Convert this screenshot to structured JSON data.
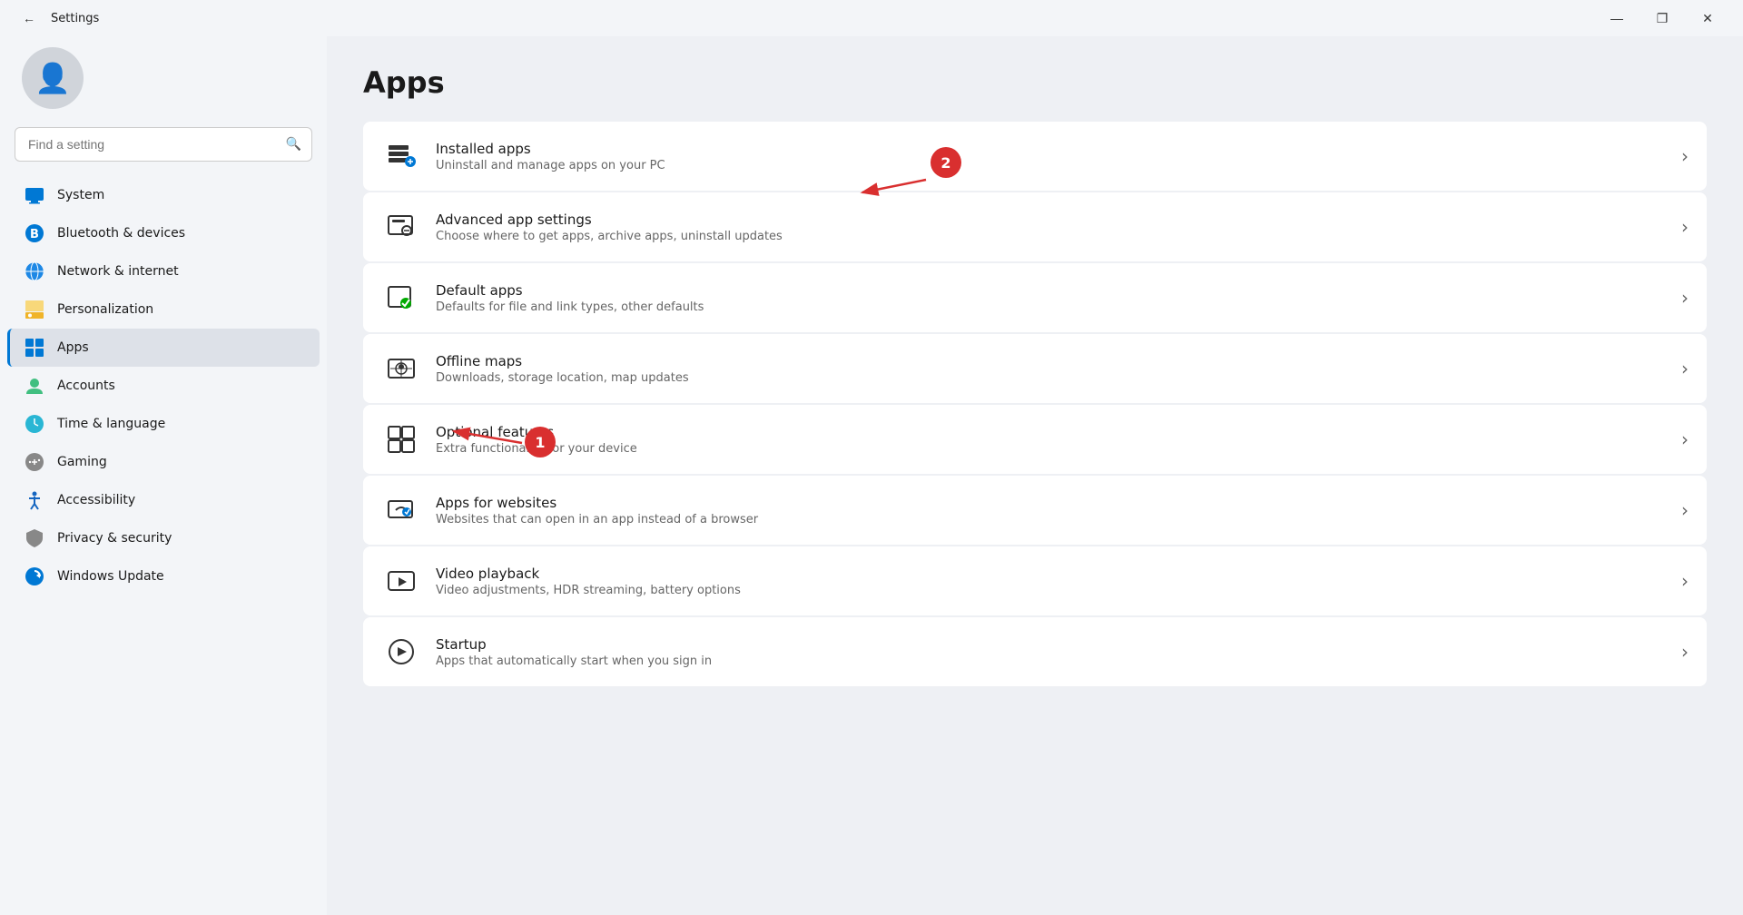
{
  "titlebar": {
    "back_label": "←",
    "title": "Settings",
    "minimize_label": "—",
    "maximize_label": "❐",
    "close_label": "✕"
  },
  "sidebar": {
    "search_placeholder": "Find a setting",
    "nav_items": [
      {
        "id": "system",
        "label": "System",
        "icon": "🖥️",
        "active": false
      },
      {
        "id": "bluetooth",
        "label": "Bluetooth & devices",
        "icon": "🔵",
        "active": false
      },
      {
        "id": "network",
        "label": "Network & internet",
        "icon": "🌐",
        "active": false
      },
      {
        "id": "personalization",
        "label": "Personalization",
        "icon": "✏️",
        "active": false
      },
      {
        "id": "apps",
        "label": "Apps",
        "icon": "📦",
        "active": true
      },
      {
        "id": "accounts",
        "label": "Accounts",
        "icon": "👤",
        "active": false
      },
      {
        "id": "time",
        "label": "Time & language",
        "icon": "🕐",
        "active": false
      },
      {
        "id": "gaming",
        "label": "Gaming",
        "icon": "🎮",
        "active": false
      },
      {
        "id": "accessibility",
        "label": "Accessibility",
        "icon": "♿",
        "active": false
      },
      {
        "id": "privacy",
        "label": "Privacy & security",
        "icon": "🛡️",
        "active": false
      },
      {
        "id": "windowsupdate",
        "label": "Windows Update",
        "icon": "🔄",
        "active": false
      }
    ]
  },
  "content": {
    "page_title": "Apps",
    "items": [
      {
        "id": "installed-apps",
        "title": "Installed apps",
        "description": "Uninstall and manage apps on your PC",
        "icon": "☰"
      },
      {
        "id": "advanced-app-settings",
        "title": "Advanced app settings",
        "description": "Choose where to get apps, archive apps, uninstall updates",
        "icon": "⚙️"
      },
      {
        "id": "default-apps",
        "title": "Default apps",
        "description": "Defaults for file and link types, other defaults",
        "icon": "✅"
      },
      {
        "id": "offline-maps",
        "title": "Offline maps",
        "description": "Downloads, storage location, map updates",
        "icon": "🗺️"
      },
      {
        "id": "optional-features",
        "title": "Optional features",
        "description": "Extra functionality for your device",
        "icon": "⊞"
      },
      {
        "id": "apps-for-websites",
        "title": "Apps for websites",
        "description": "Websites that can open in an app instead of a browser",
        "icon": "🔗"
      },
      {
        "id": "video-playback",
        "title": "Video playback",
        "description": "Video adjustments, HDR streaming, battery options",
        "icon": "📹"
      },
      {
        "id": "startup",
        "title": "Startup",
        "description": "Apps that automatically start when you sign in",
        "icon": "▶️"
      }
    ]
  },
  "annotations": {
    "badge1": "1",
    "badge2": "2"
  }
}
